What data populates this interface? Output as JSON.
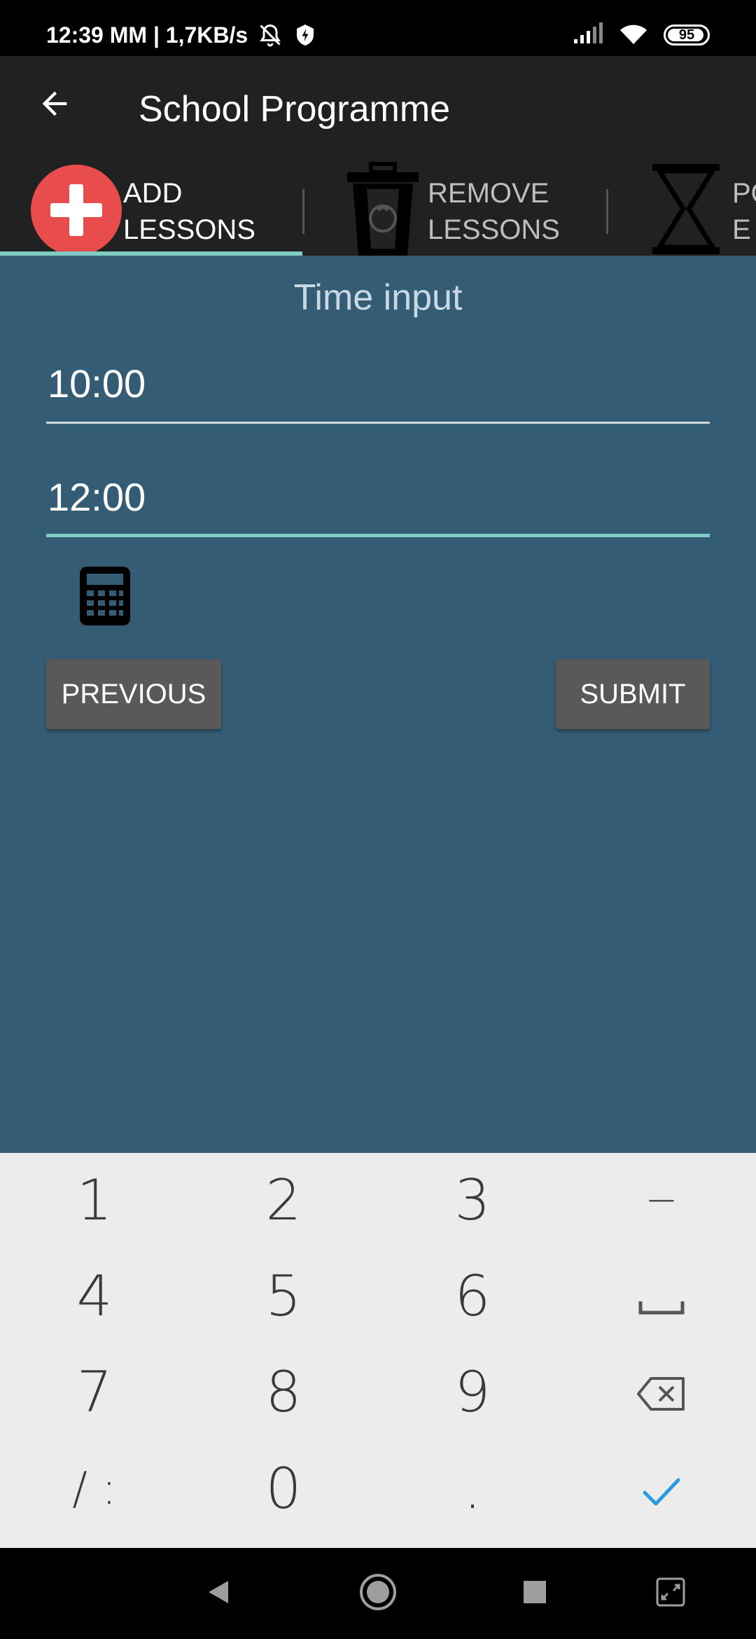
{
  "status_bar": {
    "time_network": "12:39 MM | 1,7KB/s",
    "battery": "95"
  },
  "app_bar": {
    "title": "School Programme",
    "back_icon": "arrow-left-icon"
  },
  "tabs": [
    {
      "label": "ADD\nLESSONS",
      "icon": "add-circle-icon",
      "selected": true
    },
    {
      "label": "REMOVE\nLESSONS",
      "icon": "recycle-bin-icon",
      "selected": false
    },
    {
      "label": "PO\nE",
      "icon": "hourglass-icon",
      "selected": false
    }
  ],
  "form": {
    "title": "Time input",
    "start_time": "10:00",
    "end_time": "12:00",
    "calculator_icon": "calculator-icon",
    "previous_label": "PREVIOUS",
    "submit_label": "SUBMIT"
  },
  "keyboard": {
    "rows": [
      [
        "1",
        "2",
        "3",
        "−"
      ],
      [
        "4",
        "5",
        "6",
        "space"
      ],
      [
        "7",
        "8",
        "9",
        "backspace"
      ],
      [
        "/ :",
        "0",
        ".",
        "done"
      ]
    ]
  },
  "colors": {
    "app_bar": "#212121",
    "content_bg": "#345d75",
    "accent": "#80cbc4",
    "fab_red": "#e84c4c",
    "button_bg": "#595959",
    "keyboard_bg": "#ececec",
    "check_blue": "#2b9be0"
  }
}
